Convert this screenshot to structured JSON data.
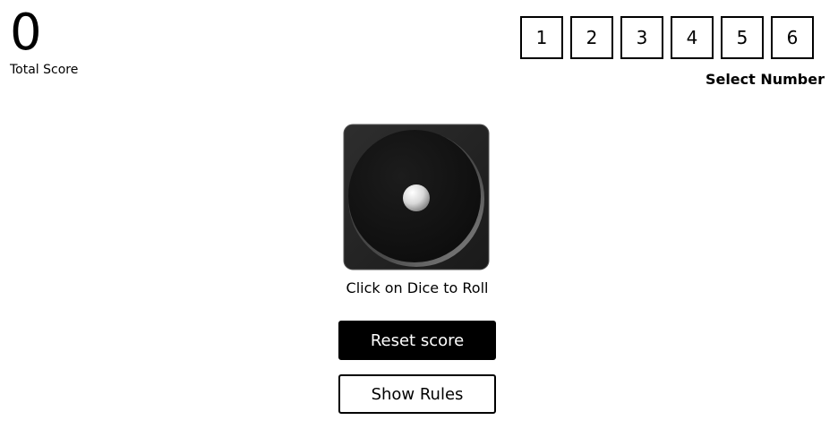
{
  "score": {
    "value": "0",
    "label": "Total Score"
  },
  "number_selector": {
    "options": [
      "1",
      "2",
      "3",
      "4",
      "5",
      "6"
    ],
    "label": "Select Number"
  },
  "dice": {
    "face_value": 1,
    "hint": "Click on Dice to Roll"
  },
  "buttons": {
    "reset": "Reset score",
    "rules": "Show Rules"
  }
}
